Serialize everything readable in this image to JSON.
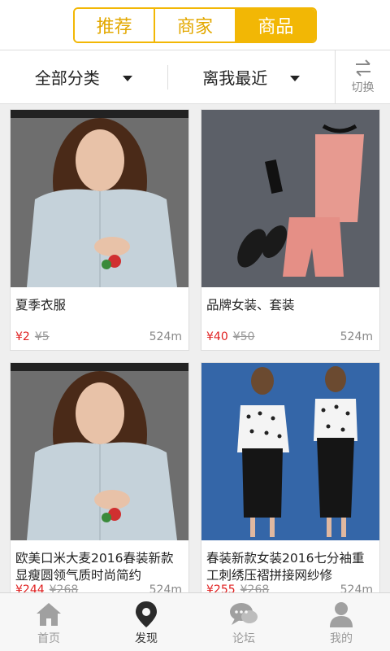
{
  "tabs": [
    {
      "label": "推荐",
      "active": false
    },
    {
      "label": "商家",
      "active": false
    },
    {
      "label": "商品",
      "active": true
    }
  ],
  "filters": {
    "category": "全部分类",
    "sort": "离我最近",
    "switch_label": "切换"
  },
  "products": [
    {
      "title": "夏季衣服",
      "price": "¥2",
      "old_price": "¥5",
      "distance": "524m",
      "image": "woman-in-light-blue-dress"
    },
    {
      "title": "品牌女装、套装",
      "price": "¥40",
      "old_price": "¥50",
      "distance": "524m",
      "image": "pink-outfit-with-sandals"
    },
    {
      "title": "欧美口米大麦2016春装新款显瘦圆领气质时尚简约",
      "price": "¥244",
      "old_price": "¥268",
      "distance": "524m",
      "image": "woman-in-light-blue-dress"
    },
    {
      "title": "春装新款女装2016七分袖重工刺绣压褶拼接网纱修",
      "price": "¥255",
      "old_price": "¥268",
      "distance": "524m",
      "image": "models-in-polka-dot-blouse"
    }
  ],
  "nav": [
    {
      "label": "首页",
      "icon": "home-icon",
      "active": false
    },
    {
      "label": "发现",
      "icon": "location-pin-icon",
      "active": true
    },
    {
      "label": "论坛",
      "icon": "chat-bubbles-icon",
      "active": false
    },
    {
      "label": "我的",
      "icon": "user-icon",
      "active": false
    }
  ],
  "colors": {
    "accent": "#f2b705",
    "price": "#e02020"
  }
}
